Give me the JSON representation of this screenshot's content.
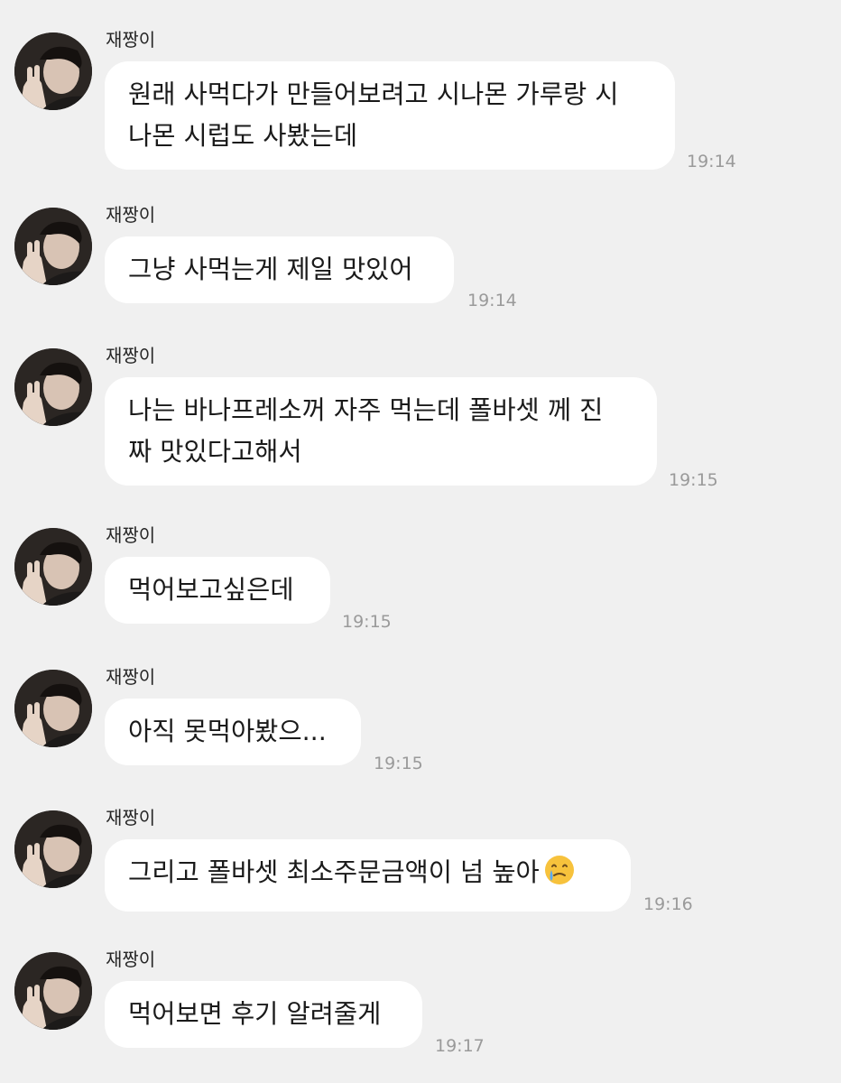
{
  "messages": [
    {
      "sender": "재짱이",
      "lines": [
        "원래 사먹다가 만들어보려고 시나몬 가루랑 시",
        "나몬 시럽도 사봤는데"
      ],
      "time": "19:14"
    },
    {
      "sender": "재짱이",
      "lines": [
        "그냥 사먹는게 제일 맛있어"
      ],
      "time": "19:14"
    },
    {
      "sender": "재짱이",
      "lines": [
        "나는 바나프레소꺼 자주 먹는데 폴바셋 께 진",
        "짜 맛있다고해서"
      ],
      "time": "19:15"
    },
    {
      "sender": "재짱이",
      "lines": [
        "먹어보고싶은데"
      ],
      "time": "19:15"
    },
    {
      "sender": "재짱이",
      "lines": [
        "아직 못먹아봤으..."
      ],
      "time": "19:15"
    },
    {
      "sender": "재짱이",
      "lines": [
        "그리고 폴바셋 최소주문금액이 넘 높아"
      ],
      "time": "19:16",
      "emoji": "tearful-smile-emoji"
    },
    {
      "sender": "재짱이",
      "lines": [
        "먹어보면 후기 알려줄게"
      ],
      "time": "19:17"
    }
  ],
  "colors": {
    "background": "#f0f0f0",
    "bubble": "#ffffff",
    "timestamp": "#9a9a9a"
  }
}
